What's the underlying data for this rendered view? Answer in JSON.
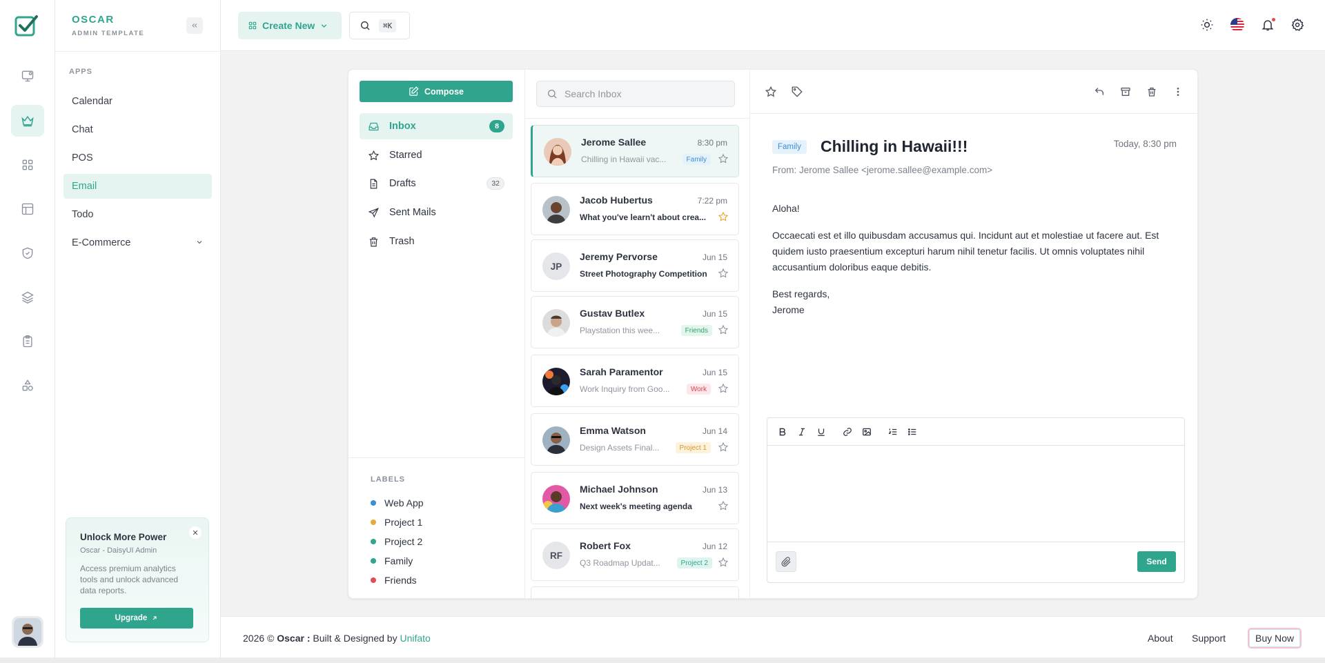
{
  "brand": {
    "name": "OSCAR",
    "subtitle": "ADMIN TEMPLATE"
  },
  "rail": {
    "icons": [
      "monitor-icon",
      "crown-icon",
      "grid-icon",
      "layout-icon",
      "shield-check-icon",
      "layers-icon",
      "clipboard-icon",
      "shapes-icon"
    ],
    "active": "crown-icon"
  },
  "sidebar": {
    "section_label": "APPS",
    "items": [
      {
        "label": "Calendar"
      },
      {
        "label": "Chat"
      },
      {
        "label": "POS"
      },
      {
        "label": "Email",
        "active": true
      },
      {
        "label": "Todo"
      },
      {
        "label": "E-Commerce",
        "has_submenu": true
      }
    ]
  },
  "promo": {
    "title": "Unlock More Power",
    "subtitle": "Oscar - DaisyUI Admin",
    "description": "Access premium analytics tools and unlock advanced data reports.",
    "button_label": "Upgrade",
    "close_glyph": "✕"
  },
  "topbar": {
    "create_label": "Create New",
    "search_shortcut": "⌘K"
  },
  "mail": {
    "compose_label": "Compose",
    "folders": [
      {
        "label": "Inbox",
        "count": "8",
        "active": true,
        "icon": "inbox-icon"
      },
      {
        "label": "Starred",
        "icon": "star-icon"
      },
      {
        "label": "Drafts",
        "count": "32",
        "icon": "file-icon"
      },
      {
        "label": "Sent Mails",
        "icon": "send-icon"
      },
      {
        "label": "Trash",
        "icon": "trash-icon"
      }
    ],
    "labels_title": "LABELS",
    "labels": [
      {
        "name": "Web App",
        "color": "#3b8fd4"
      },
      {
        "name": "Project 1",
        "color": "#e8a93a"
      },
      {
        "name": "Project 2",
        "color": "#2fa58d"
      },
      {
        "name": "Family",
        "color": "#2fa58d"
      },
      {
        "name": "Friends",
        "color": "#e14b5a"
      }
    ],
    "search_placeholder": "Search Inbox",
    "messages": [
      {
        "name": "Jerome Sallee",
        "time": "8:30 pm",
        "preview": "Chilling in Hawaii vac...",
        "tag": "Family",
        "tag_style": "blue",
        "starred": false,
        "unread": false,
        "active": true,
        "avatar": "photo"
      },
      {
        "name": "Jacob Hubertus",
        "time": "7:22 pm",
        "preview": "What you've learn't about crea...",
        "starred": true,
        "unread": true,
        "avatar": "photo"
      },
      {
        "name": "Jeremy Pervorse",
        "time": "Jun 15",
        "preview": "Street Photography Competition",
        "starred": false,
        "unread": true,
        "avatar": "initials",
        "initials": "JP"
      },
      {
        "name": "Gustav Butlex",
        "time": "Jun 15",
        "preview": "Playstation this wee...",
        "tag": "Friends",
        "tag_style": "green",
        "starred": false,
        "unread": false,
        "avatar": "photo"
      },
      {
        "name": "Sarah Paramentor",
        "time": "Jun 15",
        "preview": "Work Inquiry from Goo...",
        "tag": "Work",
        "tag_style": "red",
        "starred": false,
        "unread": false,
        "avatar": "photo"
      },
      {
        "name": "Emma Watson",
        "time": "Jun 14",
        "preview": "Design Assets Final...",
        "tag": "Project 1",
        "tag_style": "yellow",
        "starred": false,
        "unread": false,
        "avatar": "photo"
      },
      {
        "name": "Michael Johnson",
        "time": "Jun 13",
        "preview": "Next week's meeting agenda",
        "starred": false,
        "unread": true,
        "avatar": "photo"
      },
      {
        "name": "Robert Fox",
        "time": "Jun 12",
        "preview": "Q3 Roadmap Updat...",
        "tag": "Project 2",
        "tag_style": "teal",
        "starred": false,
        "unread": false,
        "avatar": "initials",
        "initials": "RF"
      }
    ]
  },
  "reader": {
    "tag": "Family",
    "subject": "Chilling in Hawaii!!!",
    "date": "Today, 8:30 pm",
    "from": "From: Jerome Sallee <jerome.sallee@example.com>",
    "greeting": "Aloha!",
    "body": "Occaecati est et illo quibusdam accusamus qui. Incidunt aut et molestiae ut facere aut. Est quidem iusto praesentium excepturi harum nihil tenetur facilis. Ut omnis voluptates nihil accusantium doloribus eaque debitis.",
    "signoff": "Best regards,",
    "signature": "Jerome",
    "send_label": "Send"
  },
  "footer": {
    "year": "2026 ©",
    "brand": "Oscar :",
    "built": "Built & Designed by",
    "company": "Unifato",
    "links": [
      "About",
      "Support"
    ],
    "buy_label": "Buy Now"
  },
  "colors": {
    "accent": "#2fa58d",
    "accent_soft": "#e6f4f1"
  }
}
